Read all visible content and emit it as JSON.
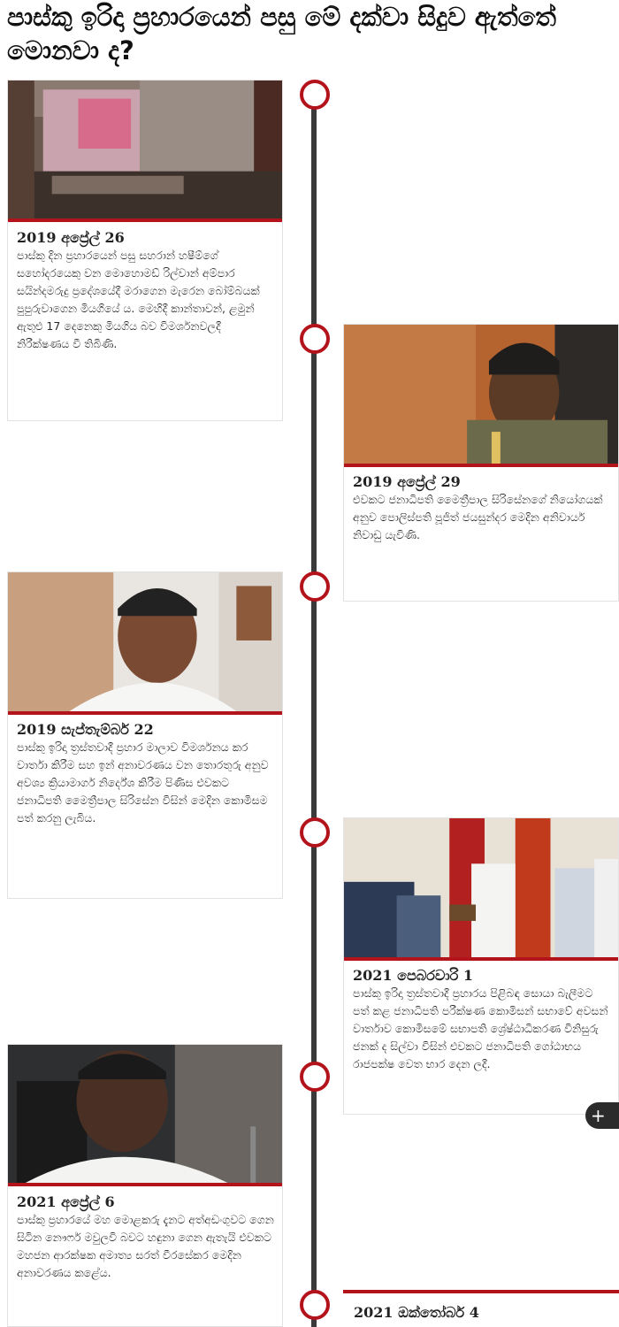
{
  "title": "පාස්කු ඉරිදා ප්‍රහාරයෙන් පසු මේ දක්වා සිදුව ඇත්තේ මොනවා ද?",
  "accent_color": "#b3131b",
  "timeline": [
    {
      "date": "2019 අප්‍රේල් 26",
      "text": "පාස්කු දින ප්‍රහාරයෙන් පසු සහරාන් හෂීම්ගේ සහෝදරයෙකු වන මොහොමඩ් රිල්වාන් අම්පාර සයින්දමරුදු ප්‍රදේශයේදී මරාගෙන මැරෙන බෝම්බයක් පුපුරුවාගෙන මියගියේ ය. මෙහිදී කාන්තාවන්, ළමුන් ඇතුළු 17 දෙනෙකු මියගිය බව විමර්ශනවලදී නිරීක්ෂණය වී තිබිණි.",
      "photo_icon": "burned-building-photo"
    },
    {
      "date": "2019 අප්‍රේල් 29",
      "text": "එවකට ජනාධිපති මෛත්‍රීපාල සිරිසේනගේ නියෝගයක් අනුව පොලිස්පති පූජිත් ජයසුන්දර මෙදින අනිවාර්ය නිවාඩු යැවිණි.",
      "photo_icon": "police-chief-photo"
    },
    {
      "date": "2019 සැප්තැම්බර් 22",
      "text": "පාස්කු ඉරිදා ත්‍රස්තවාදී ප්‍රහාර මාලාව විමර්ශනය කර වාර්තා කිරීම සහ ඉන් අනාවරණය වන තොරතුරු අනුව අවශ්‍ය ක්‍රියාමාර්ග නිර්දේශ කිරීම පිණිස එවකට ජනාධිපති මෛත්‍රීපාල සිරිසේන විසින් මෙදින කොමිසම පත් කරනු ලැබිය.",
      "photo_icon": "former-president-photo"
    },
    {
      "date": "2021 පෙබරවාරි 1",
      "text": "පාස්කු ඉරිදා ත්‍රස්තවාදී ප්‍රහාරය පිළිබඳ සොයා බැලීමට පත් කළ ජනාධිපති පරීක්ෂණ කොමිසන් සභාවේ අවසන් වාර්තාව කොමිසමේ සභාපති ශ්‍රේෂ්ඨාධිකරණ විනිසුරු ජනක් ද සිල්වා විසින් එවකට ජනාධිපති ගෝඨාභය රාජපක්ෂ වෙත භාර දෙන ලදී.",
      "photo_icon": "report-handover-photo"
    },
    {
      "date": "2021 අප්‍රේල් 6",
      "text": "පාස්කු ප්‍රහාරයේ මහ මොළකරු දැනට අත්අඩංගුවට ගෙන සිටින නෞෆර් මවුලවි බවට හඳුනා ගෙන ඇතැයි එවකට මහජන ආරක්ෂක අමාත්‍ය සරත් වීරසේකර මෙදින අනාවරණය කළේය.",
      "photo_icon": "minister-photo"
    },
    {
      "date": "2021 ඔක්තෝබර් 4"
    }
  ],
  "fab_label": "+"
}
